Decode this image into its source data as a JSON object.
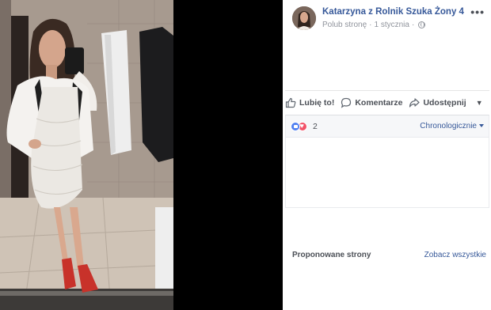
{
  "post": {
    "author": "Katarzyna z Rolnik Szuka Żony 4",
    "like_page": "Polub stronę",
    "separator": "·",
    "date": "1 stycznia",
    "more_label": "•••"
  },
  "actions": {
    "like": "Lubię to!",
    "comment": "Komentarze",
    "share": "Udostępnij",
    "more": "▼"
  },
  "reactions": {
    "count": "2",
    "sort": "Chronologicznie"
  },
  "suggested": {
    "title": "Proponowane strony",
    "see_all": "Zobacz wszystkie"
  },
  "colors": {
    "link": "#365899",
    "text": "#4b4f56",
    "muted": "#90949c",
    "like_blue": "#4f7ff0",
    "love_red": "#f25268",
    "backdrop": "#000000"
  },
  "icons": [
    "thumb-up-icon",
    "comment-icon",
    "share-icon",
    "globe-icon",
    "like-reaction-icon",
    "love-reaction-icon"
  ]
}
